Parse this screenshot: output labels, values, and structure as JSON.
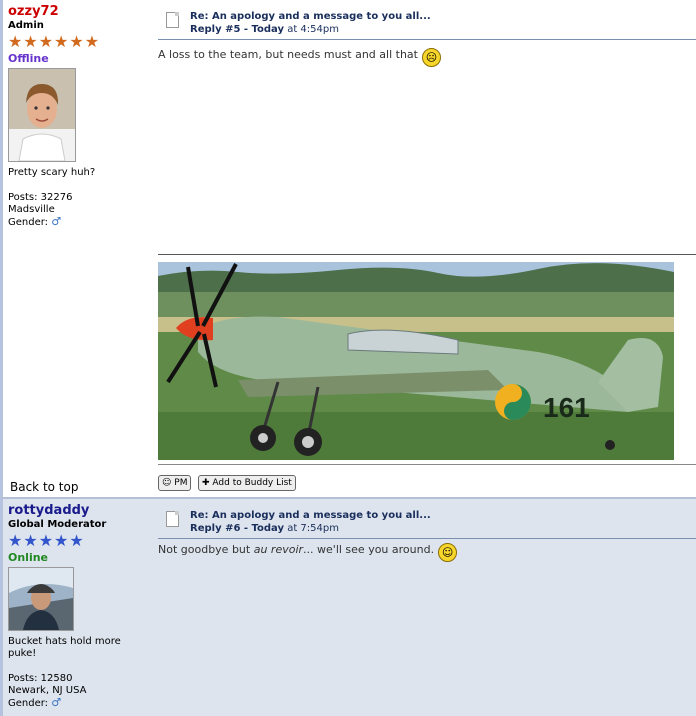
{
  "posts": [
    {
      "username": "ozzy72",
      "username_color": "#cc0000",
      "role": "Admin",
      "star_color": "#d26a1e",
      "status": "Offline",
      "status_color": "#6633cc",
      "signature": "Pretty scary huh?",
      "posts_label": "Posts: 32276",
      "location": "Madsville",
      "gender_label": "Gender:",
      "gender_icon": "male-icon",
      "title": "Re: An apology and a message to you all...",
      "reply_label": "Reply #5 - Today",
      "time": "at 4:54pm",
      "message": "A loss to the team, but needs must and all that",
      "smiley": "sad-smiley-icon",
      "aircraft_marking": "161",
      "back_to_top": "Back to top",
      "pm_label": "PM",
      "buddy_label": "Add to Buddy List"
    },
    {
      "username": "rottydaddy",
      "username_color": "#1a1a8c",
      "role": "Global Moderator",
      "star_color": "#3355cc",
      "status": "Online",
      "status_color": "#228822",
      "signature": "Bucket hats hold more puke!",
      "posts_label": "Posts: 12580",
      "location": "Newark, NJ USA",
      "gender_label": "Gender:",
      "gender_icon": "male-icon",
      "title": "Re: An apology and a message to you all...",
      "reply_label": "Reply #6 - Today",
      "time": "at 7:54pm",
      "message_before": "Not goodbye but ",
      "message_italic": "au revoir",
      "message_after": "... we'll see you around.",
      "smiley": "happy-smiley-icon"
    }
  ]
}
